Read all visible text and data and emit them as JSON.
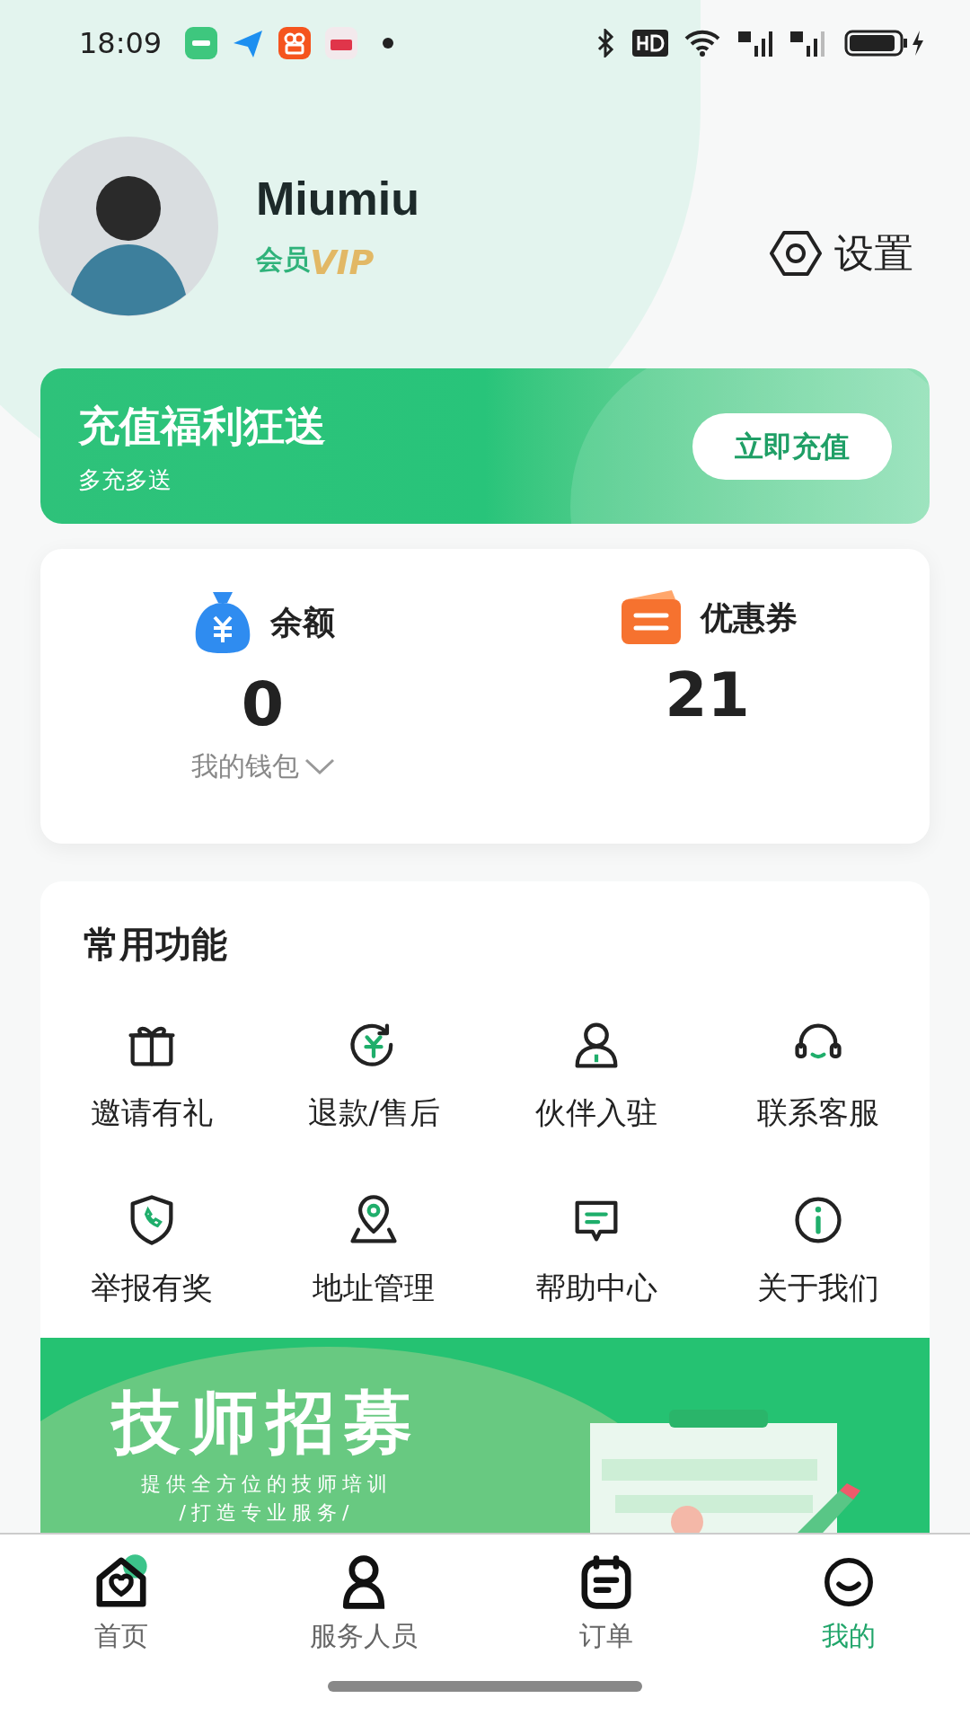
{
  "status_bar": {
    "time": "18:09"
  },
  "profile": {
    "name": "Miumiu",
    "member_label": "会员",
    "vip_badge": "VIP",
    "settings": "设置"
  },
  "promo": {
    "title": "充值福利狂送",
    "subtitle": "多充多送",
    "button": "立即充值"
  },
  "wallet": [
    {
      "kind": "balance",
      "label": "余额",
      "value": "0",
      "link": "我的钱包"
    },
    {
      "kind": "coupon",
      "label": "优惠券",
      "value": "21"
    }
  ],
  "features": {
    "title": "常用功能",
    "items": [
      {
        "label": "邀请有礼"
      },
      {
        "label": "退款/售后"
      },
      {
        "label": "伙伴入驻"
      },
      {
        "label": "联系客服"
      },
      {
        "label": "举报有奖"
      },
      {
        "label": "地址管理"
      },
      {
        "label": "帮助中心"
      },
      {
        "label": "关于我们"
      }
    ]
  },
  "recruit_banner": {
    "title": "技师招募",
    "subtitle": "提供全方位的技师培训",
    "tagline": "/打造专业服务/"
  },
  "bottom_nav": [
    {
      "label": "首页",
      "selected": false
    },
    {
      "label": "服务人员",
      "selected": false
    },
    {
      "label": "订单",
      "selected": false
    },
    {
      "label": "我的",
      "selected": true
    }
  ]
}
